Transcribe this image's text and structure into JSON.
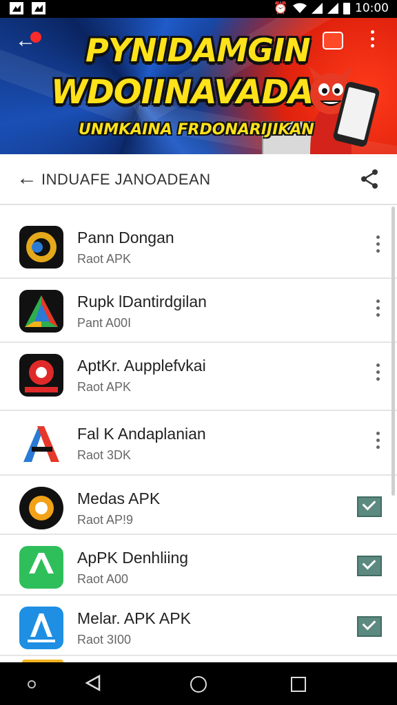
{
  "status_bar": {
    "time": "10:00"
  },
  "banner": {
    "title_line1": "PYNIDAMGIN",
    "title_line2": "WDOIINAVADAI",
    "subtitle": "UNMKAINA FRDONARIJIKAN"
  },
  "app_bar": {
    "title": "INDUAFE JANOADEAN"
  },
  "apps": [
    {
      "name": "Pann Dongan",
      "subtitle": "Raot APK",
      "action": "menu"
    },
    {
      "name": "Rupk lDantirdgilan",
      "subtitle": "Pant A00I",
      "action": "menu"
    },
    {
      "name": "AptKr. Aupplefvkai",
      "subtitle": "Raot APK",
      "action": "menu"
    },
    {
      "name": "Fal K Andaplanian",
      "subtitle": "Raot 3DK",
      "action": "menu"
    },
    {
      "name": "Medas APK",
      "subtitle": "Raot AP!9",
      "action": "check"
    },
    {
      "name": "ApPK Denhliing",
      "subtitle": "Raot A00",
      "action": "check"
    },
    {
      "name": "Melar. APK APK",
      "subtitle": "Raot 3I00",
      "action": "check"
    }
  ],
  "icons": [
    "wifi-icon",
    "signal-icon",
    "battery-icon",
    "back-arrow-icon",
    "chat-icon",
    "more-icon",
    "share-icon",
    "nav-back-icon",
    "nav-home-icon",
    "nav-recent-icon"
  ],
  "colors": {
    "banner_yellow": "#ffe21a",
    "check_green": "#5c8a80",
    "divider": "#e4e4e4"
  }
}
